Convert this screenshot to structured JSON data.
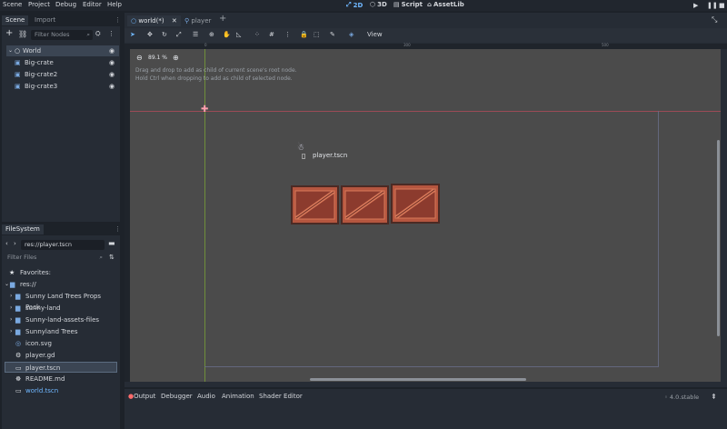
{
  "menu": [
    "Scene",
    "Project",
    "Debug",
    "Editor",
    "Help"
  ],
  "workspaces": [
    {
      "label": "2D",
      "icon": "2d-view-icon"
    },
    {
      "label": "3D",
      "icon": "3d-view-icon"
    },
    {
      "label": "Script",
      "icon": "script-icon"
    },
    {
      "label": "AssetLib",
      "icon": "assetlib-icon"
    }
  ],
  "scene_dock": {
    "tabs": [
      "Scene",
      "Import"
    ],
    "filter_placeholder": "Filter Nodes",
    "nodes": [
      {
        "label": "World",
        "selected": true
      },
      {
        "label": "Big-crate"
      },
      {
        "label": "Big-crate2"
      },
      {
        "label": "Big-crate3"
      }
    ]
  },
  "filesystem": {
    "tab": "FileSystem",
    "path": "res://player.tscn",
    "filter_placeholder": "Filter Files",
    "favorites": "Favorites:",
    "root": "res://",
    "items": [
      {
        "label": "Sunny Land Trees Props Pack",
        "type": "folder"
      },
      {
        "label": "sunny-land",
        "type": "folder"
      },
      {
        "label": "Sunny-land-assets-files",
        "type": "folder"
      },
      {
        "label": "Sunnyland Trees",
        "type": "folder"
      },
      {
        "label": "icon.svg",
        "type": "image"
      },
      {
        "label": "player.gd",
        "type": "script"
      },
      {
        "label": "player.tscn",
        "type": "scene",
        "selected": true
      },
      {
        "label": "README.md",
        "type": "text"
      },
      {
        "label": "world.tscn",
        "type": "scene",
        "highlight": true
      }
    ]
  },
  "editor_tabs": [
    {
      "label": "world(*)",
      "active": true
    },
    {
      "label": "player",
      "active": false
    }
  ],
  "toolbar": {
    "view_label": "View"
  },
  "viewport": {
    "zoom": "89.1 %",
    "hint_line1": "Drag and drop to add as child of current scene's root node.",
    "hint_line2": "Hold Ctrl when dropping to add as child of selected node.",
    "drag_label": "player.tscn",
    "ruler_marks": [
      "0",
      "300",
      "500"
    ]
  },
  "bottom_panel": {
    "tabs": [
      "Output",
      "Debugger",
      "Audio",
      "Animation",
      "Shader Editor"
    ],
    "version": "4.0.stable"
  },
  "colors": {
    "accent": "#6fb7ff",
    "crate": "#b5563f",
    "folder": "#7aa9e0"
  }
}
